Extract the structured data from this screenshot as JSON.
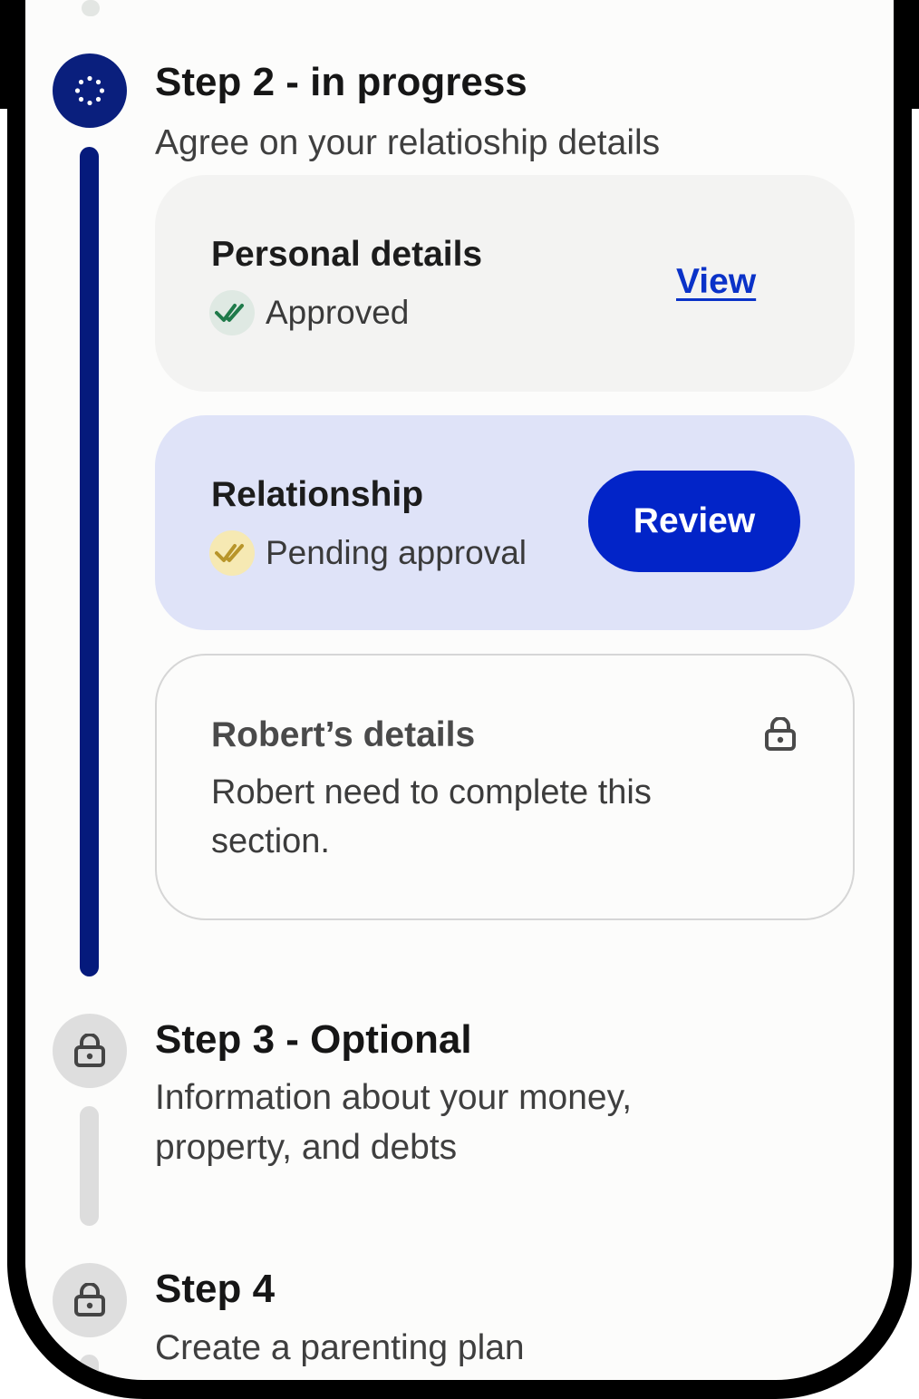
{
  "step2": {
    "title": "Step 2 - in progress",
    "subtitle": "Agree on your relatioship details",
    "cards": [
      {
        "title": "Personal details",
        "status": "Approved",
        "action": "View"
      },
      {
        "title": "Relationship",
        "status": "Pending approval",
        "action": "Review"
      },
      {
        "title": "Robert’s details",
        "message": "Robert need to complete this section."
      }
    ]
  },
  "step3": {
    "title": "Step 3 - Optional",
    "subtitle": "Information about your money, property, and debts"
  },
  "step4": {
    "title": "Step 4",
    "subtitle": "Create a parenting plan"
  },
  "colors": {
    "accent": "#0224c8",
    "active_step": "#0a1f7d",
    "approved": "#1f7a4a",
    "pending": "#b8952a"
  },
  "icons": {
    "step2": "progress-spinner-icon",
    "approved": "double-check-icon",
    "pending": "double-check-icon",
    "locked": "lock-icon"
  }
}
